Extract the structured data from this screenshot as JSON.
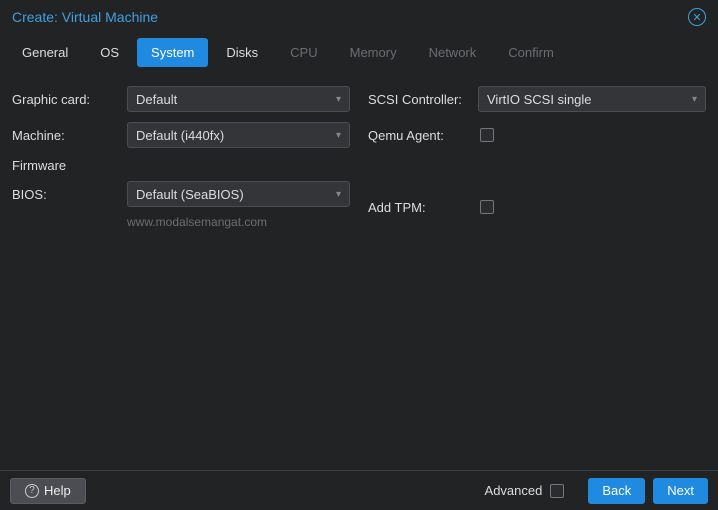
{
  "title": "Create: Virtual Machine",
  "tabs": [
    {
      "label": "General",
      "state": "enabled"
    },
    {
      "label": "OS",
      "state": "enabled"
    },
    {
      "label": "System",
      "state": "active"
    },
    {
      "label": "Disks",
      "state": "enabled"
    },
    {
      "label": "CPU",
      "state": "disabled"
    },
    {
      "label": "Memory",
      "state": "disabled"
    },
    {
      "label": "Network",
      "state": "disabled"
    },
    {
      "label": "Confirm",
      "state": "disabled"
    }
  ],
  "form": {
    "left": {
      "graphic_label": "Graphic card:",
      "graphic_value": "Default",
      "machine_label": "Machine:",
      "machine_value": "Default (i440fx)",
      "firmware_label": "Firmware",
      "bios_label": "BIOS:",
      "bios_value": "Default (SeaBIOS)"
    },
    "right": {
      "scsi_label": "SCSI Controller:",
      "scsi_value": "VirtIO SCSI single",
      "qemu_label": "Qemu Agent:",
      "tpm_label": "Add TPM:"
    }
  },
  "watermark": "www.modalsemangat.com",
  "footer": {
    "help": "Help",
    "advanced": "Advanced",
    "back": "Back",
    "next": "Next"
  }
}
